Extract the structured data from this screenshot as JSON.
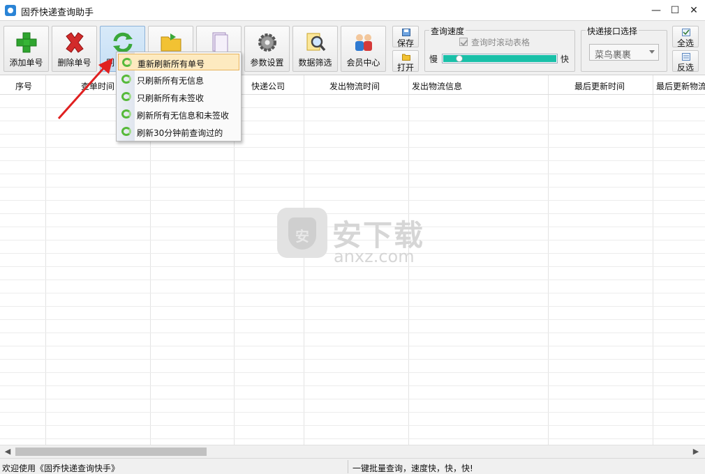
{
  "window": {
    "title": "固乔快递查询助手",
    "min_glyph": "—",
    "max_glyph": "☐",
    "close_glyph": "✕"
  },
  "toolbar": {
    "buttons": [
      {
        "label": "添加单号",
        "icon": "green-plus-icon"
      },
      {
        "label": "删除单号",
        "icon": "red-x-icon"
      },
      {
        "label": "刷",
        "icon": "refresh-icon"
      },
      {
        "label": "",
        "icon": "folder-icon"
      },
      {
        "label": "",
        "icon": "document-icon"
      },
      {
        "label": "参数设置",
        "icon": "gear-icon"
      },
      {
        "label": "数据筛选",
        "icon": "search-document-icon"
      },
      {
        "label": "会员中心",
        "icon": "members-icon"
      }
    ],
    "save_label": "保存",
    "open_label": "打开",
    "select_all_label": "全选",
    "invert_label": "反选"
  },
  "speed": {
    "group_title": "查询速度",
    "scroll_checkbox_label": "查询时滚动表格",
    "slow_label": "慢",
    "fast_label": "快",
    "level": 0.12
  },
  "api": {
    "group_title": "快递接口选择",
    "selected": "菜鸟裹裹"
  },
  "table": {
    "columns": [
      "序号",
      "查单时间",
      "",
      "快递公司",
      "发出物流时间",
      "发出物流信息",
      "最后更新时间",
      "最后更新物流"
    ]
  },
  "context_menu": {
    "items": [
      {
        "label": "重新刷新所有单号",
        "highlighted": true
      },
      {
        "label": "只刷新所有无信息",
        "highlighted": false
      },
      {
        "label": "只刷新所有未签收",
        "highlighted": false
      },
      {
        "label": "刷新所有无信息和未签收",
        "highlighted": false
      },
      {
        "label": "刷新30分钟前查询过的",
        "highlighted": false
      }
    ]
  },
  "watermark": {
    "main": "安下载",
    "sub": "anxz.com",
    "badge": "安"
  },
  "status": {
    "left": "欢迎使用《固乔快递查询快手》",
    "right": "一键批量查询，速度快，快，快!"
  },
  "colors": {
    "accent": "#19c0a8",
    "menu_highlight": "#fdeac0",
    "arrow": "#e02020"
  }
}
